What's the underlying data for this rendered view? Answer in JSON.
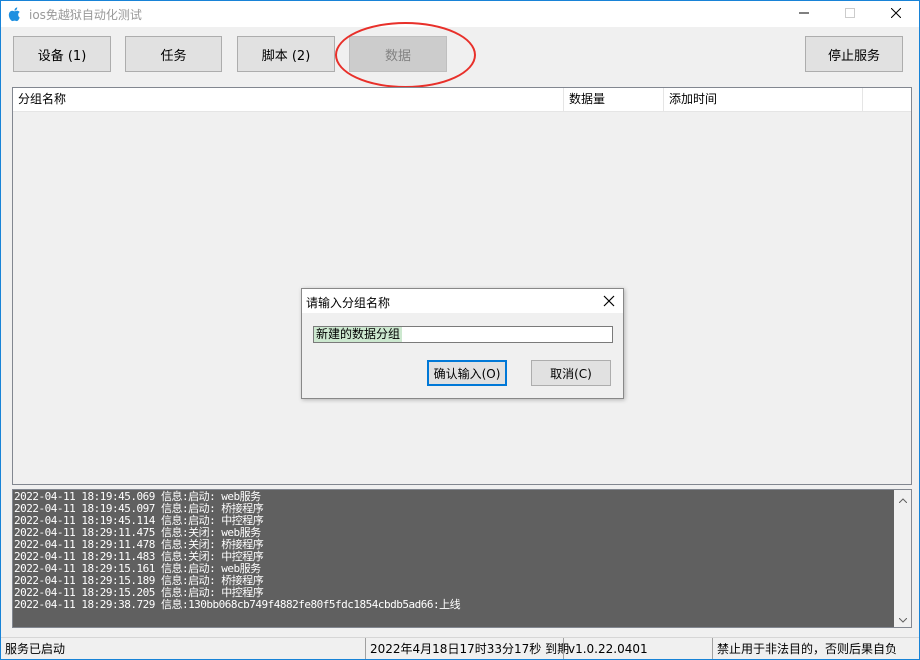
{
  "window": {
    "title": "ios免越狱自动化测试"
  },
  "toolbar": {
    "devices_label": "设备 (1)",
    "tasks_label": "任务",
    "scripts_label": "脚本 (2)",
    "data_label": "数据",
    "stop_service_label": "停止服务"
  },
  "list": {
    "columns": [
      "分组名称",
      "数据量",
      "添加时间"
    ]
  },
  "dialog": {
    "title": "请输入分组名称",
    "input_value": "新建的数据分组",
    "confirm_label": "确认输入(O)",
    "cancel_label": "取消(C)"
  },
  "log": {
    "lines": [
      "2022-04-11 18:19:45.069 信息:启动: web服务",
      "2022-04-11 18:19:45.097 信息:启动: 桥接程序",
      "2022-04-11 18:19:45.114 信息:启动: 中控程序",
      "2022-04-11 18:29:11.475 信息:关闭: web服务",
      "2022-04-11 18:29:11.478 信息:关闭: 桥接程序",
      "2022-04-11 18:29:11.483 信息:关闭: 中控程序",
      "2022-04-11 18:29:15.161 信息:启动: web服务",
      "2022-04-11 18:29:15.189 信息:启动: 桥接程序",
      "2022-04-11 18:29:15.205 信息:启动: 中控程序",
      "2022-04-11 18:29:38.729 信息:130bb068cb749f4882fe80f5fdc1854cbdb5ad66:上线"
    ]
  },
  "status": {
    "service_status": "服务已启动",
    "expiry": "2022年4月18日17时33分17秒 到期",
    "version": "v1.0.22.0401",
    "notice": "禁止用于非法目的，否则后果自负"
  },
  "colors": {
    "accent": "#0078d7",
    "highlight_circle": "#e8302a",
    "log_background": "#606060",
    "selection": "#cce8cf"
  }
}
